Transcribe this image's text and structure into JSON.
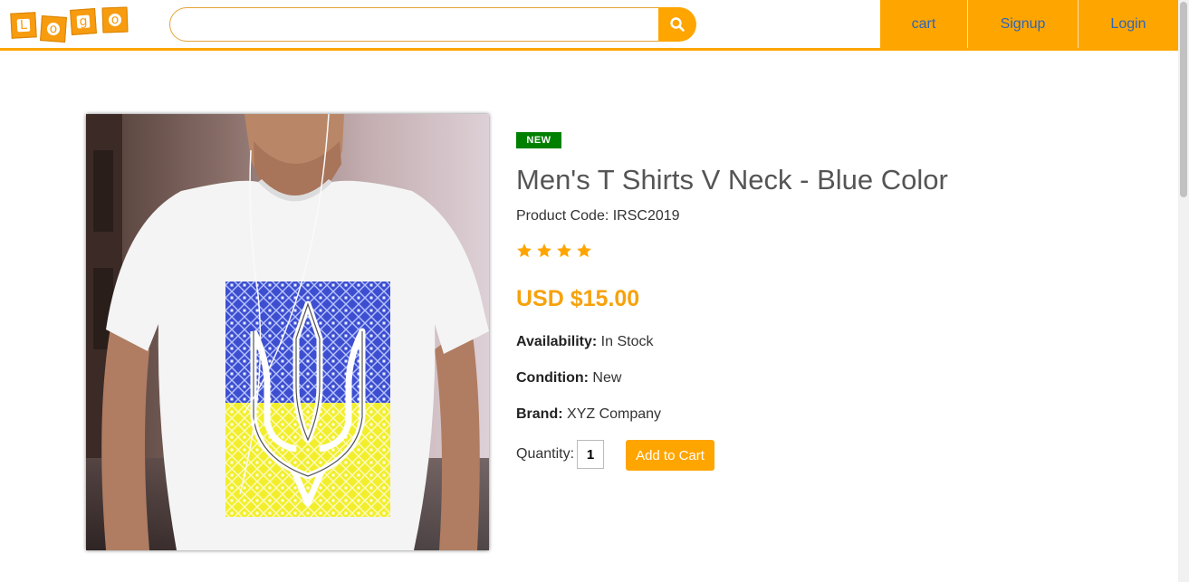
{
  "header": {
    "logo_letters": [
      "L",
      "o",
      "g",
      "o"
    ],
    "search": {
      "value": "",
      "placeholder": ""
    },
    "nav": [
      "cart",
      "Signup",
      "Login"
    ]
  },
  "product": {
    "badge": "NEW",
    "title": "Men's T Shirts V Neck - Blue Color",
    "code_label": "Product Code:",
    "code_value": "IRSC2019",
    "rating": 4,
    "rating_max": 4,
    "price": "USD $15.00",
    "availability_label": "Availability:",
    "availability_value": "In Stock",
    "condition_label": "Condition:",
    "condition_value": "New",
    "brand_label": "Brand:",
    "brand_value": "XYZ Company",
    "quantity_label": "Quantity:",
    "quantity_value": "1",
    "add_button": "Add to Cart"
  },
  "colors": {
    "accent": "#ffa500",
    "nav_text": "#2b66b8",
    "badge": "#008000",
    "price": "#f7a20c"
  },
  "icons": {
    "search": "search-icon",
    "star": "star-icon"
  }
}
